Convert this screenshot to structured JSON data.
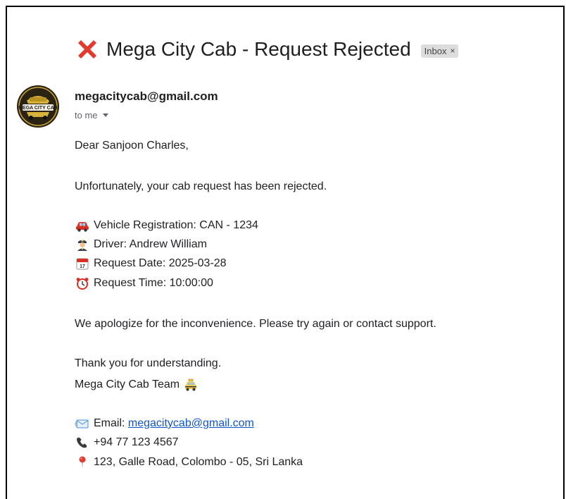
{
  "email": {
    "subject": "Mega City Cab - Request Rejected",
    "label_chip": "Inbox",
    "label_chip_close": "×",
    "sender_email": "megacitycab@gmail.com",
    "recipient": "to me",
    "avatar_logo_text": "MEGA CITY CAB",
    "body": {
      "greeting": "Dear Sanjoon Charles,",
      "intro": "Unfortunately, your cab request has been rejected.",
      "details": [
        {
          "icon": "car-icon",
          "text": "Vehicle Registration: CAN - 1234"
        },
        {
          "icon": "driver-icon",
          "text": "Driver: Andrew William"
        },
        {
          "icon": "calendar-icon",
          "text": "Request Date: 2025-03-28"
        },
        {
          "icon": "alarm-clock-icon",
          "text": "Request Time: 10:00:00"
        }
      ],
      "apology": "We apologize for the inconvenience. Please try again or contact support.",
      "thanks": "Thank you for understanding.",
      "signoff": "Mega City Cab Team",
      "contact": {
        "email_label": "Email: ",
        "email_link": "megacitycab@gmail.com",
        "phone": "+94 77 123 4567",
        "address": "123, Galle Road, Colombo - 05, Sri Lanka"
      }
    }
  },
  "colors": {
    "reject_red": "#e23a2e",
    "link_blue": "#1155cc",
    "chip_bg": "#dddddd"
  }
}
